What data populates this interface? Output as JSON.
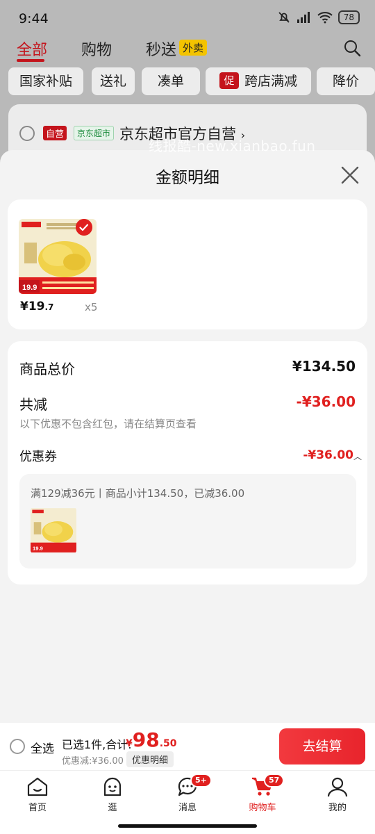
{
  "status_bar": {
    "time": "9:44",
    "battery": "78"
  },
  "top_tabs": [
    {
      "label": "全部",
      "active": true
    },
    {
      "label": "购物"
    },
    {
      "label": "秒送"
    }
  ],
  "waimai_badge": "外卖",
  "filter_chips": [
    "国家补贴",
    "送礼",
    "凑单",
    "跨店满减",
    "降价"
  ],
  "promo_chip_tag": "促",
  "store": {
    "self_tag": "自营",
    "market_tag": "京东超市",
    "name": "京东超市官方自营",
    "arrow": "›"
  },
  "watermark": "线报酷-new.xianbao.fun",
  "sheet": {
    "title": "金额明细",
    "product": {
      "price_int": "¥19",
      "price_dec": ".7",
      "qty": "x5",
      "image_price": "19.9"
    },
    "goods_total_label": "商品总价",
    "goods_total_value": "¥134.50",
    "reduce_label": "共减",
    "reduce_value": "-¥36.00",
    "reduce_note": "以下优惠不包含红包，请在结算页查看",
    "coupon_label": "优惠券",
    "coupon_value": "-¥36.00",
    "coupon_detail": "满129减36元丨商品小计134.50，已减36.00"
  },
  "checkout": {
    "select_all": "全选",
    "selected_text": "已选1件,合计:",
    "total_yen": "¥",
    "total_int": "98",
    "total_dec": ".50",
    "discount_text": "优惠减:¥36.00",
    "detail_button": "优惠明细",
    "pay_button": "去结算"
  },
  "bottom_nav": [
    {
      "label": "首页"
    },
    {
      "label": "逛"
    },
    {
      "label": "消息",
      "badge": "5+"
    },
    {
      "label": "购物车",
      "badge": "57",
      "active": true
    },
    {
      "label": "我的"
    }
  ],
  "colors": {
    "accent": "#e0201f",
    "brand_red": "#c4141c",
    "sheet_bg": "#f3f3f3"
  }
}
